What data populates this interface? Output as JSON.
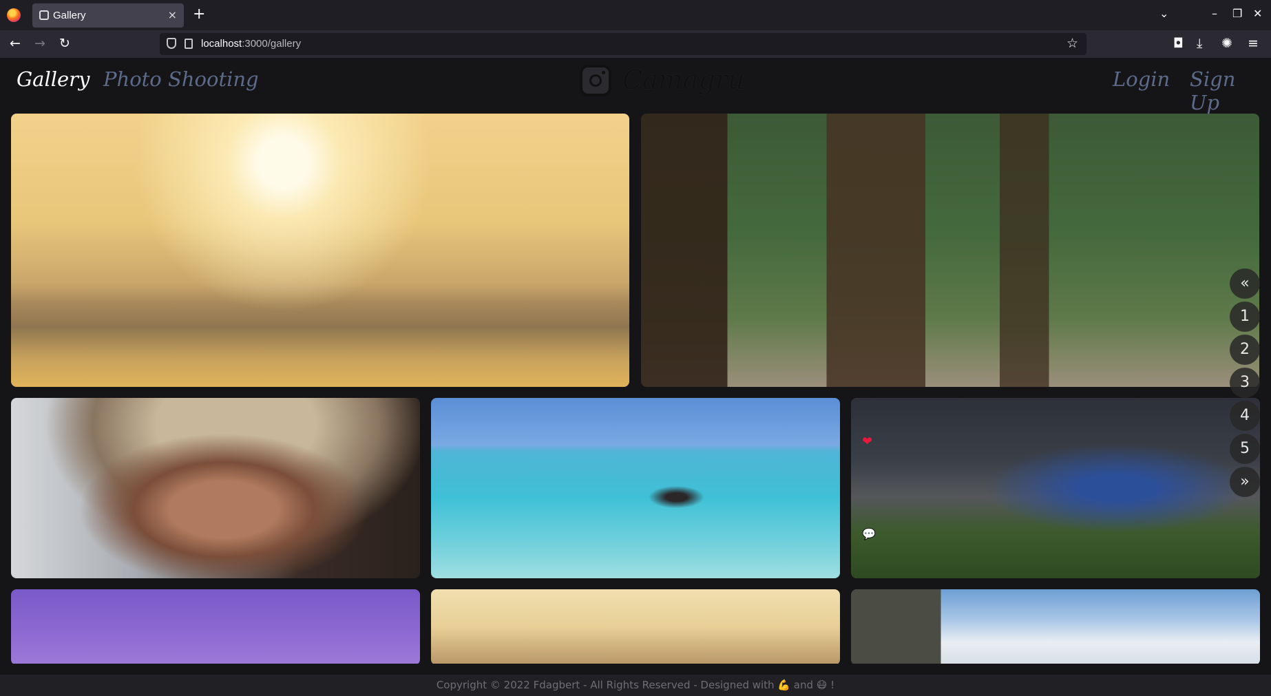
{
  "browser": {
    "tab_title": "Gallery",
    "tab_close": "×",
    "new_tab": "+",
    "url_host": "localhost",
    "url_path": ":3000/gallery",
    "nav_back": "←",
    "nav_forward": "→",
    "nav_reload": "↻",
    "bookmark_star": "☆",
    "tab_list": "⌄",
    "window_minimize": "–",
    "window_restore": "❐",
    "window_close": "✕",
    "toolbar_pocket": "◘",
    "toolbar_download": "⤓",
    "toolbar_extension": "✺",
    "toolbar_menu": "≡"
  },
  "header": {
    "nav_gallery": "Gallery",
    "nav_photo_shooting": "Photo Shooting",
    "logo_text": "Camagru",
    "nav_login": "Login",
    "nav_signup": "Sign Up"
  },
  "gallery": {
    "like_icon": "❤",
    "comment_icon": "💬"
  },
  "pagination": {
    "prev": "«",
    "pages": [
      "1",
      "2",
      "3",
      "4",
      "5"
    ],
    "next": "»"
  },
  "footer": {
    "text": "Copyright © 2022 Fdagbert - All Rights Reserved - Designed with 💪 and 😷 !"
  },
  "colors": {
    "page_bg": "#151518",
    "nav_dim": "#5c6b8a",
    "footer_bg": "#212125",
    "like": "#e8193c"
  }
}
